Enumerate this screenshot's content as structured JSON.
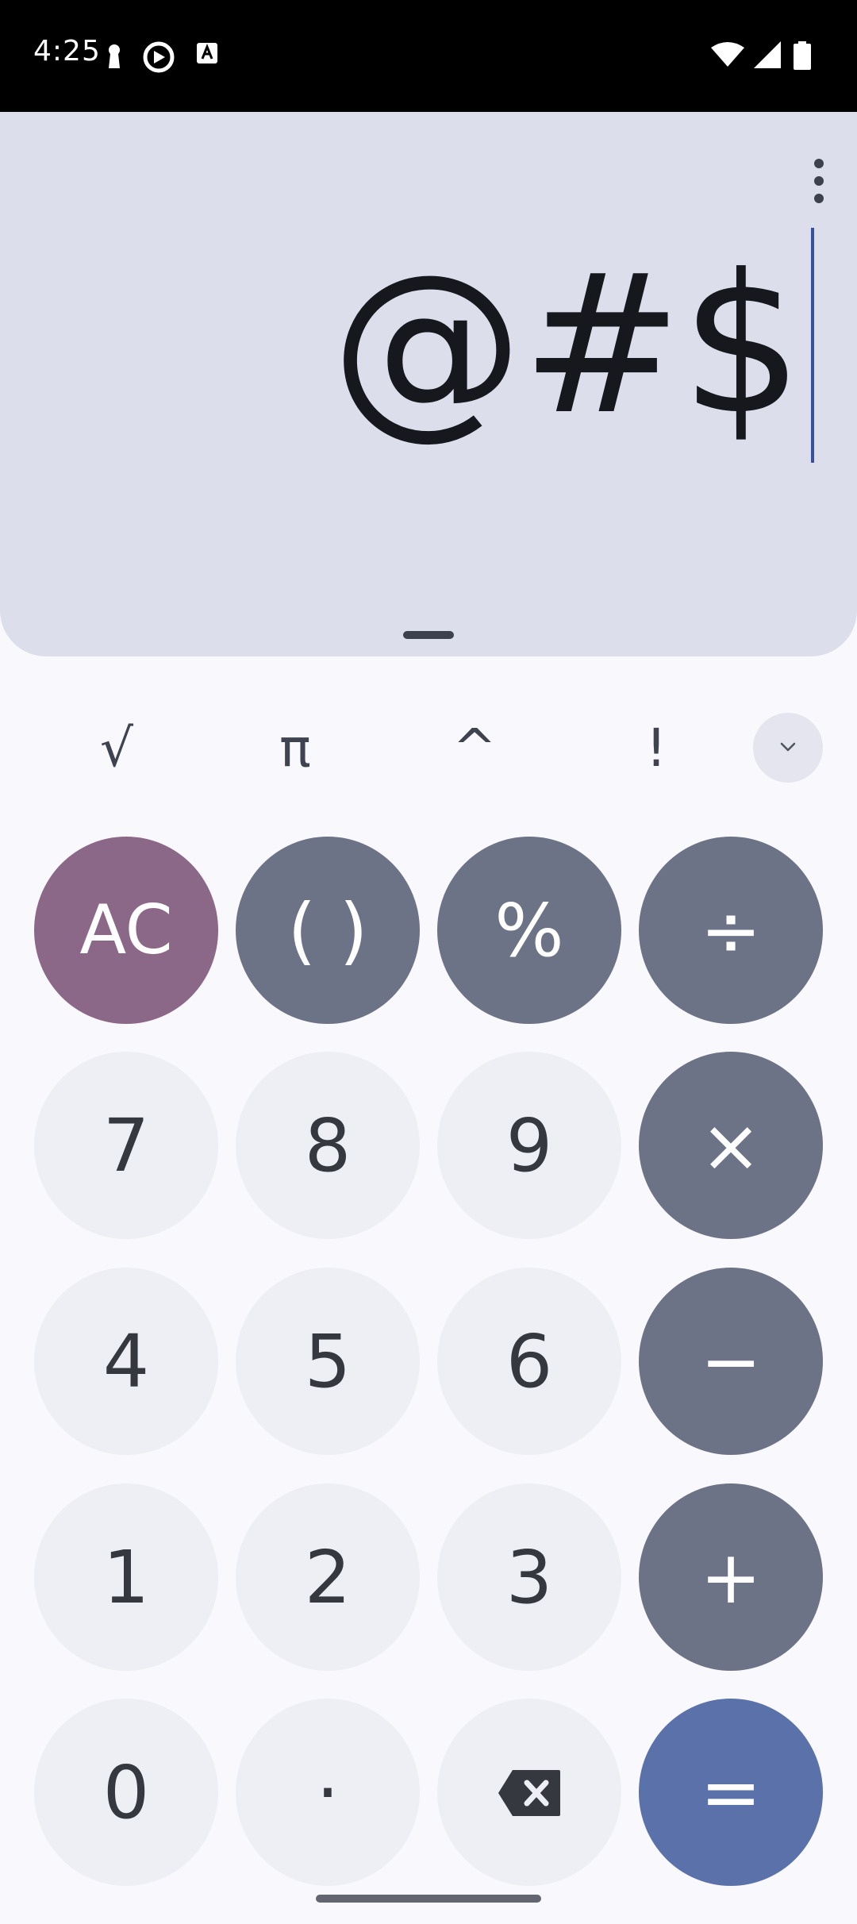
{
  "status_bar": {
    "time": "4:25",
    "left_icons": [
      "keyhole-icon",
      "sync-icon",
      "translate-icon"
    ],
    "right_icons": [
      "wifi-icon",
      "signal-icon",
      "battery-icon"
    ]
  },
  "display": {
    "expression": "@#$",
    "menu_icon": "more-vert-icon"
  },
  "scientific_keys": [
    "√",
    "π",
    "^",
    "!"
  ],
  "expand_icon": "chevron-down-icon",
  "keypad": {
    "clear": "AC",
    "parens": "( )",
    "percent": "%",
    "divide": "÷",
    "seven": "7",
    "eight": "8",
    "nine": "9",
    "multiply": "×",
    "four": "4",
    "five": "5",
    "six": "6",
    "minus": "−",
    "one": "1",
    "two": "2",
    "three": "3",
    "plus": "+",
    "zero": "0",
    "decimal": "·",
    "backspace_icon": "backspace-icon",
    "equals": "="
  },
  "colors": {
    "display_bg": "#dcdfeb",
    "number_key": "#eeeef5",
    "operator_key": "#6c7386",
    "clear_key": "#8c6888",
    "equals_key": "#5b71aa",
    "caret": "#3850a0"
  }
}
